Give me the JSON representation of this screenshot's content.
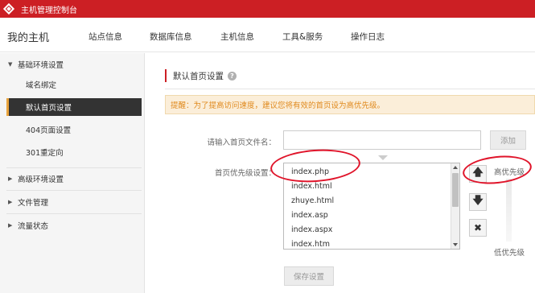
{
  "topbar": {
    "title": "主机管理控制台"
  },
  "nav": {
    "title": "我的主机",
    "items": [
      "站点信息",
      "数据库信息",
      "主机信息",
      "工具&服务",
      "操作日志"
    ]
  },
  "sidebar": {
    "group_basic": "基础环境设置",
    "items": [
      "域名绑定",
      "默认首页设置",
      "404页面设置",
      "301重定向"
    ],
    "group_advanced": "高级环境设置",
    "group_files": "文件管理",
    "group_traffic": "流量状态"
  },
  "main": {
    "section_title": "默认首页设置",
    "notice": "提醒：为了提高访问速度，建议您将有效的首页设为高优先级。",
    "input_label": "请输入首页文件名：",
    "add_button": "添加",
    "priority_label": "首页优先级设置：",
    "options": [
      "index.php",
      "index.html",
      "zhuye.html",
      "index.asp",
      "index.aspx",
      "index.htm"
    ],
    "high_priority": "高优先级",
    "low_priority": "低优先级",
    "save_button": "保存设置",
    "move_up_glyph": "🡅",
    "move_down_glyph": "🡇",
    "delete_glyph": "✖"
  },
  "colors": {
    "brand": "#cc1f24",
    "active_marker": "#e8a33d",
    "annotation": "#e0142a",
    "notice_text": "#e08a1e"
  }
}
